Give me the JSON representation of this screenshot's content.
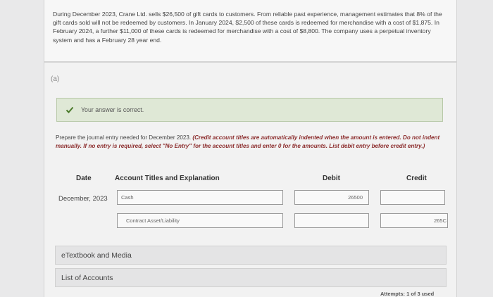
{
  "problem": {
    "text": "During December 2023, Crane Ltd. sells $26,500 of gift cards to customers. From reliable past experience, management estimates that 8% of the gift cards sold will not be redeemed by customers. In January 2024, $2,500 of these cards is redeemed for merchandise with a cost of $1,875. In February 2024, a further $11,000 of these cards is redeemed for merchandise with a cost of $8,800. The company uses a perpetual inventory system and has a February 28 year end."
  },
  "part": {
    "label": "(a)"
  },
  "feedback": {
    "text": "Your answer is correct."
  },
  "instructions": {
    "plain": "Prepare the journal entry needed for December 2023. ",
    "italic": "(Credit account titles are automatically indented when the amount is entered. Do not indent manually. If no entry is required, select \"No Entry\" for the account titles and enter 0 for the amounts. List debit entry before credit entry.)"
  },
  "table": {
    "headers": {
      "date": "Date",
      "account": "Account Titles and Explanation",
      "debit": "Debit",
      "credit": "Credit"
    },
    "rows": [
      {
        "date": "December, 2023",
        "account": "Cash",
        "debit": "26500",
        "credit": ""
      },
      {
        "date": "",
        "account": "Contract Asset/Liability",
        "debit": "",
        "credit": "265C"
      }
    ]
  },
  "links": {
    "etextbook": "eTextbook and Media",
    "accounts": "List of Accounts"
  },
  "footer": {
    "attempts": "Attempts: 1 of 3 used"
  },
  "colors": {
    "correct_bg": "#dfe8d6",
    "check": "#4a7a2a",
    "instruction_italic": "#8b2b2b"
  }
}
